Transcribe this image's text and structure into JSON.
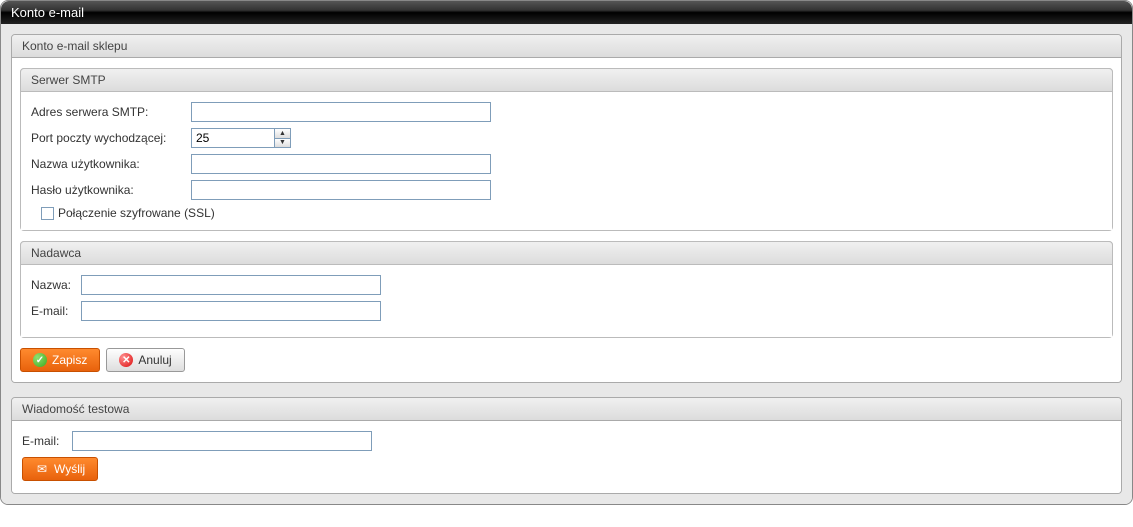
{
  "window": {
    "title": "Konto e-mail"
  },
  "panel": {
    "title": "Konto e-mail sklepu"
  },
  "smtp": {
    "legend": "Serwer SMTP",
    "server_label": "Adres serwera SMTP:",
    "server_value": "",
    "port_label": "Port poczty wychodzącej:",
    "port_value": "25",
    "user_label": "Nazwa użytkownika:",
    "user_value": "",
    "pass_label": "Hasło użytkownika:",
    "pass_value": "",
    "ssl_label": "Połączenie szyfrowane (SSL)",
    "ssl_checked": false
  },
  "sender": {
    "legend": "Nadawca",
    "name_label": "Nazwa:",
    "name_value": "",
    "email_label": "E-mail:",
    "email_value": ""
  },
  "buttons": {
    "save": "Zapisz",
    "cancel": "Anuluj",
    "send": "Wyślij"
  },
  "test": {
    "legend": "Wiadomość testowa",
    "email_label": "E-mail:",
    "email_value": ""
  }
}
